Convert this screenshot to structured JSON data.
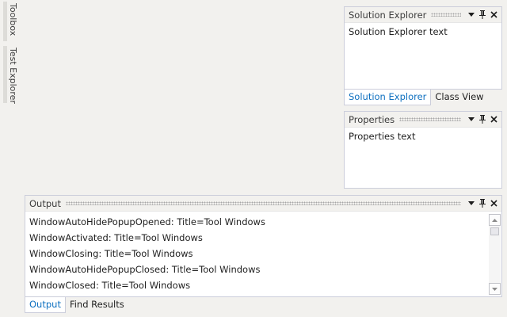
{
  "autohide": {
    "toolbox_label": "Toolbox",
    "testexplorer_label": "Test Explorer"
  },
  "solution_explorer": {
    "title": "Solution Explorer",
    "body_text": "Solution Explorer text",
    "tabs": [
      {
        "label": "Solution Explorer",
        "active": true
      },
      {
        "label": "Class View",
        "active": false
      }
    ]
  },
  "properties": {
    "title": "Properties",
    "body_text": "Properties text"
  },
  "output": {
    "title": "Output",
    "lines": [
      "WindowAutoHidePopupOpened: Title=Tool Windows",
      "WindowActivated: Title=Tool Windows",
      "WindowClosing: Title=Tool Windows",
      "WindowAutoHidePopupClosed: Title=Tool Windows",
      "WindowClosed: Title=Tool Windows"
    ],
    "tabs": [
      {
        "label": "Output",
        "active": true
      },
      {
        "label": "Find Results",
        "active": false
      }
    ]
  },
  "header_glyphs": {
    "dropdown": "▾",
    "pin": "📌",
    "close": "✕"
  },
  "colors": {
    "accent": "#0e70c0",
    "background": "#f2f1ee"
  }
}
